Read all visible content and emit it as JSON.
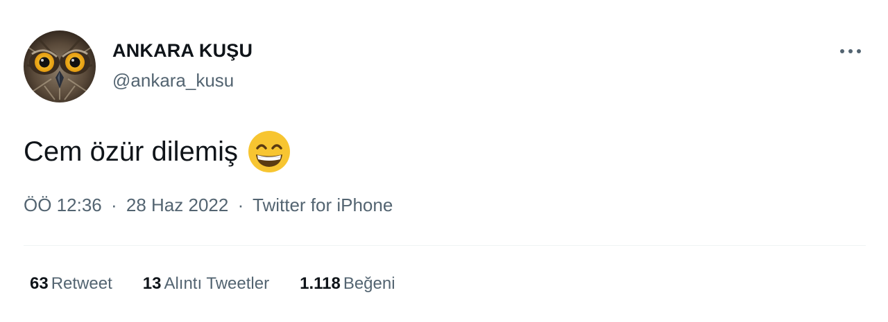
{
  "author": {
    "display_name": "ANKARA KUŞU",
    "handle": "@ankara_kusu",
    "avatar_icon": "owl-avatar-icon"
  },
  "tweet": {
    "text": "Cem özür dilemiş",
    "emoji": "grinning-face-with-smiling-eyes-emoji"
  },
  "meta": {
    "time": "ÖÖ 12:36",
    "date": "28 Haz 2022",
    "source": "Twitter for iPhone",
    "separator": "·"
  },
  "stats": [
    {
      "count": "63",
      "label": "Retweet"
    },
    {
      "count": "13",
      "label": "Alıntı Tweetler"
    },
    {
      "count": "1.118",
      "label": "Beğeni"
    }
  ],
  "more_icon": "more-options-icon",
  "colors": {
    "primary_text": "#0f1419",
    "secondary_text": "#536471",
    "divider": "#eff3f4",
    "emoji_yellow": "#f7c531"
  }
}
